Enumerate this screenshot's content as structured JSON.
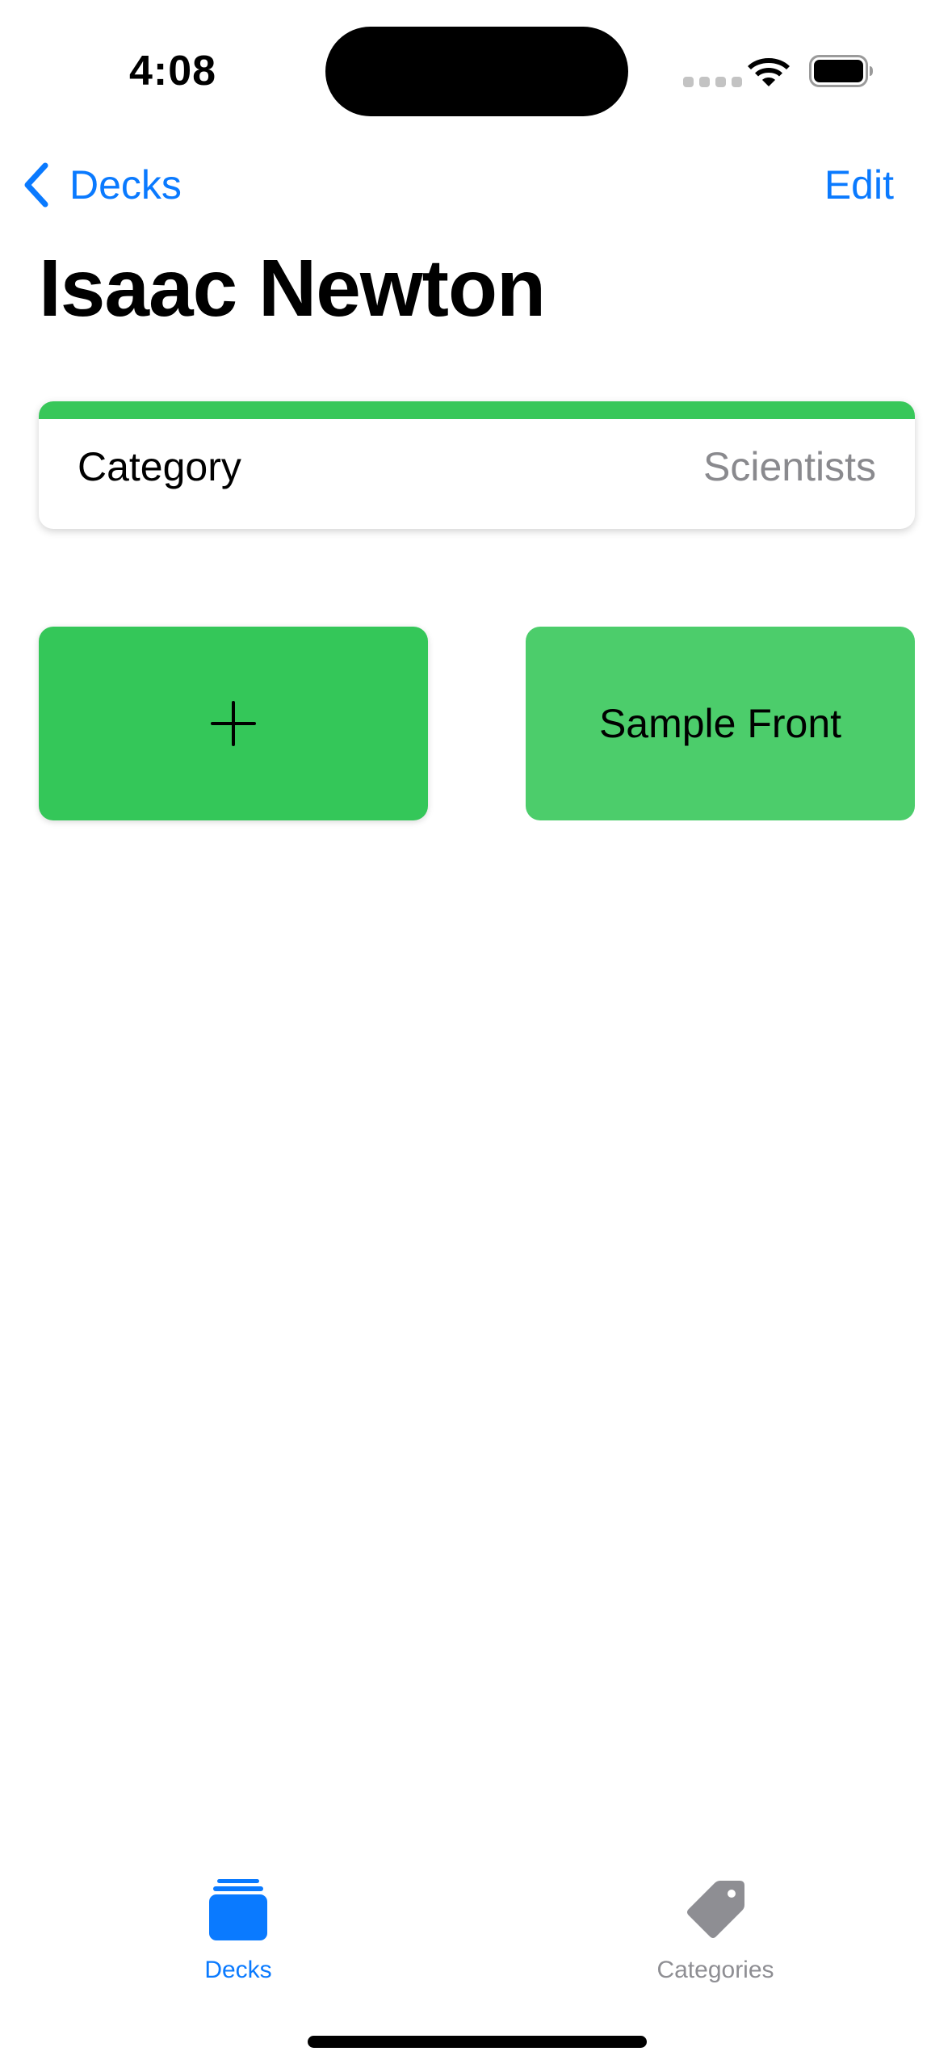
{
  "status_bar": {
    "time": "4:08",
    "icons": [
      "cellular-dots-icon",
      "wifi-icon",
      "battery-icon"
    ]
  },
  "nav": {
    "back_label": "Decks",
    "edit_label": "Edit",
    "back_icon": "chevron-left-icon"
  },
  "page": {
    "title": "Isaac Newton"
  },
  "category": {
    "label": "Category",
    "value": "Scientists",
    "accent_color": "#38c75a"
  },
  "cards": {
    "add_icon": "plus-icon",
    "add_color": "#34c759",
    "items": [
      {
        "front": "Sample Front",
        "color": "#4ccd6b"
      }
    ]
  },
  "tab_bar": {
    "active_color": "#0a7aff",
    "inactive_color": "#8e8e93",
    "tabs": [
      {
        "label": "Decks",
        "icon": "stack-icon",
        "active": true
      },
      {
        "label": "Categories",
        "icon": "tag-icon",
        "active": false
      }
    ]
  }
}
